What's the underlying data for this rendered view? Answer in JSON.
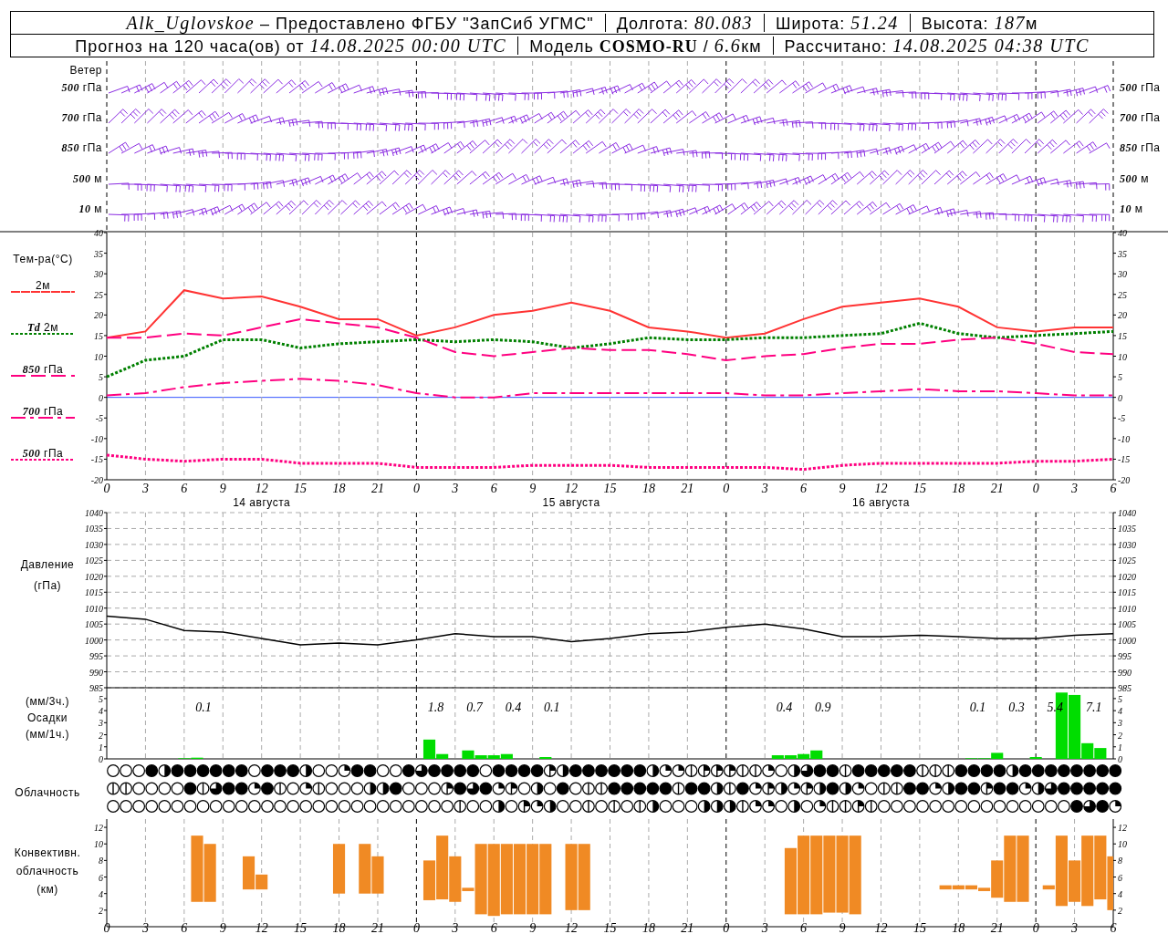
{
  "header": {
    "rows": [
      [
        {
          "parts": [
            {
              "kind": "italic",
              "text": "Alk_Uglovskoe"
            },
            {
              "kind": "plain",
              "text": " – Предоставлено ФГБУ \"ЗапСиб УГМС\""
            }
          ]
        },
        {
          "parts": [
            {
              "kind": "plain",
              "text": "Долгота: "
            },
            {
              "kind": "italic",
              "text": "80.083"
            }
          ]
        },
        {
          "parts": [
            {
              "kind": "plain",
              "text": "Широта: "
            },
            {
              "kind": "italic",
              "text": "51.24"
            }
          ]
        },
        {
          "parts": [
            {
              "kind": "plain",
              "text": "Высота: "
            },
            {
              "kind": "italic",
              "text": "187"
            },
            {
              "kind": "plain",
              "text": "м"
            }
          ]
        }
      ],
      [
        {
          "parts": [
            {
              "kind": "plain",
              "text": "Прогноз на 120 часа(ов) от "
            },
            {
              "kind": "italic",
              "text": "14.08.2025 00:00 UTC"
            }
          ]
        },
        {
          "parts": [
            {
              "kind": "plain",
              "text": "Модель "
            },
            {
              "kind": "bold",
              "text": "COSMO-RU"
            },
            {
              "kind": "plain",
              "text": " / "
            },
            {
              "kind": "italic",
              "text": "6.6"
            },
            {
              "kind": "plain",
              "text": "км"
            }
          ]
        },
        {
          "parts": [
            {
              "kind": "plain",
              "text": "Рассчитано: "
            },
            {
              "kind": "italic",
              "text": "14.08.2025 04:38 UTC"
            }
          ]
        }
      ]
    ]
  },
  "wind": {
    "title": "Ветер",
    "levels": [
      {
        "left": "500 гПа",
        "right": "500 гПа"
      },
      {
        "left": "700 гПа",
        "right": "700 гПа"
      },
      {
        "left": "850 гПа",
        "right": "850 гПа"
      },
      {
        "left": "500 м",
        "right": "500 м"
      },
      {
        "left": "10 м",
        "right": "10 м"
      }
    ]
  },
  "temperature": {
    "dates": [
      "14 августа",
      "15 августа",
      "16 августа"
    ],
    "right_axis_labels": [
      "40",
      "35",
      "30",
      "25",
      "20",
      "15",
      "10",
      "5",
      "0",
      "-5",
      "-10",
      "-15",
      "-20"
    ],
    "chart_data": {
      "type": "line",
      "ylabel": "Тем-ра(°C)",
      "grid": true,
      "legend": "left",
      "categories": [
        "0",
        "3",
        "6",
        "9",
        "12",
        "15",
        "18",
        "21",
        "0",
        "3",
        "6",
        "9",
        "12",
        "15",
        "18",
        "21",
        "0",
        "3",
        "6",
        "9",
        "12",
        "15",
        "18",
        "21",
        "0",
        "3",
        "6"
      ],
      "ylim": [
        -20,
        40
      ],
      "yticks": [
        -20,
        -15,
        -10,
        -5,
        0,
        5,
        10,
        15,
        20,
        25,
        30,
        35,
        40
      ],
      "series": [
        {
          "name": "2м",
          "color": "#ff3333",
          "line_style": "solid",
          "values": [
            14.5,
            16,
            26,
            24,
            24.5,
            22,
            19,
            19,
            15,
            17,
            20,
            21,
            23,
            21,
            17,
            16,
            14.5,
            15.5,
            19,
            22,
            23,
            24,
            22,
            17,
            16,
            17,
            17
          ]
        },
        {
          "name": "Td 2м",
          "color": "#008000",
          "line_style": "dotted",
          "values": [
            5,
            9,
            10,
            14,
            14,
            12,
            13,
            13.5,
            14,
            13.5,
            14,
            13.5,
            12,
            13,
            14.5,
            14,
            14,
            14.5,
            14.5,
            15,
            15.5,
            18,
            15.5,
            14.5,
            15,
            15.5,
            16
          ]
        },
        {
          "name": "850 гПа",
          "color": "#ff0080",
          "line_style": "dashed",
          "values": [
            14.5,
            14.5,
            15.5,
            15,
            17,
            19,
            18,
            17,
            14.5,
            11,
            10,
            11,
            12,
            11.5,
            11.5,
            10.5,
            9,
            10,
            10.5,
            12,
            13,
            13,
            14,
            14.5,
            13,
            11,
            10.5
          ]
        },
        {
          "name": "700 гПа",
          "color": "#ff0080",
          "line_style": "dashdot",
          "values": [
            0.5,
            1,
            2.5,
            3.5,
            4,
            4.5,
            4,
            3,
            1,
            0,
            0,
            1,
            1,
            1,
            1,
            1,
            1,
            0.5,
            0.5,
            1,
            1.5,
            2,
            1.5,
            1.5,
            1,
            0.5,
            0.5
          ]
        },
        {
          "name": "500 гПа",
          "color": "#ff0080",
          "line_style": "dotted",
          "values": [
            -14,
            -15,
            -15.5,
            -15,
            -15,
            -16,
            -16,
            -16,
            -17,
            -17,
            -17,
            -16.5,
            -16.5,
            -16.5,
            -17,
            -17,
            -17,
            -17,
            -17.5,
            -16.5,
            -16,
            -16,
            -16,
            -16,
            -15.5,
            -15.5,
            -15
          ]
        }
      ]
    }
  },
  "pressure": {
    "unit": "(гПа)",
    "right_axis_labels": [
      "1040",
      "1035",
      "1030",
      "1025",
      "1020",
      "1015",
      "1010",
      "1005",
      "1000",
      "995",
      "990",
      "985"
    ],
    "chart_data": {
      "type": "line",
      "ylabel": "Давление",
      "grid": true,
      "color": "#000000",
      "categories": [
        null,
        null,
        null,
        null,
        null,
        null,
        null,
        null,
        null,
        null,
        null,
        null,
        null,
        null,
        null,
        null,
        null,
        null,
        null,
        null,
        null,
        null,
        null,
        null,
        null,
        null,
        null
      ],
      "ylim": [
        985,
        1040
      ],
      "yticks": [
        985,
        990,
        995,
        1000,
        1005,
        1010,
        1015,
        1020,
        1025,
        1030,
        1035,
        1040
      ],
      "values": [
        1007.5,
        1006.5,
        1003,
        1002.5,
        1000.5,
        998.5,
        999,
        998.5,
        1000,
        1002,
        1001,
        1001,
        999.5,
        1000.5,
        1002,
        1002.5,
        1004,
        1005,
        1003.5,
        1001,
        1001,
        1001.5,
        1001,
        1000.5,
        1000.5,
        1001.5,
        1002
      ]
    }
  },
  "precipitation": {
    "labels": [
      "(мм/3ч.)",
      "Осадки",
      "(мм/1ч.)"
    ],
    "right_axis_labels": [
      "5",
      "4",
      "3",
      "2",
      "1",
      "0"
    ],
    "chart_data": {
      "type": "bar",
      "grid": true,
      "color": "#00dd00",
      "categories": [
        null,
        null,
        null,
        null,
        null,
        null,
        null,
        null,
        null,
        null,
        null,
        null,
        null,
        null,
        null,
        null,
        null,
        null,
        null,
        null,
        null,
        null,
        null,
        null,
        null,
        null,
        null,
        null,
        null,
        null,
        null,
        null,
        null,
        null,
        null,
        null,
        null,
        null,
        null,
        null,
        null,
        null,
        null,
        null,
        null,
        null,
        null,
        null,
        null,
        null,
        null,
        null,
        null,
        null,
        null,
        null,
        null,
        null,
        null,
        null,
        null,
        null,
        null,
        null,
        null,
        null,
        null,
        null,
        null,
        null,
        null,
        null,
        null,
        null,
        null,
        null,
        null,
        null,
        null
      ],
      "values": [
        0,
        0,
        0,
        0,
        0,
        0,
        0.05,
        0.1,
        0,
        0,
        0,
        0,
        0,
        0,
        0,
        0,
        0,
        0,
        0,
        0,
        0,
        0,
        0,
        0,
        0,
        1.6,
        0.4,
        0,
        0.7,
        0.3,
        0.3,
        0.4,
        0,
        0,
        0.15,
        0,
        0,
        0,
        0,
        0,
        0,
        0,
        0,
        0,
        0,
        0,
        0,
        0,
        0,
        0,
        0,
        0,
        0.3,
        0.3,
        0.4,
        0.7,
        0,
        0,
        0,
        0,
        0,
        0,
        0,
        0,
        0,
        0,
        0,
        0.05,
        0.05,
        0.5,
        0,
        0,
        0.15,
        0,
        5.5,
        5.3,
        1.3,
        0.9,
        0
      ],
      "ylim": [
        0,
        5.9
      ],
      "yticks": [
        0,
        1,
        2,
        3,
        4,
        5
      ],
      "annotations": [
        "0.1",
        "1.8",
        "0.7",
        "0.4",
        "0.1",
        "0.4",
        "0.9",
        "0.1",
        "0.3",
        "5.4",
        "7.1"
      ]
    }
  },
  "cloudiness": {
    "label": "Облачность",
    "rows": [
      {
        "cells": [
          {
            "kind": "clear"
          },
          {
            "kind": "clear"
          },
          {
            "kind": "clear"
          },
          {
            "kind": "overcast"
          },
          {
            "kind": "half"
          },
          {
            "kind": "overcast"
          },
          {
            "kind": "overcast"
          },
          {
            "kind": "overcast"
          },
          {
            "kind": "overcast"
          },
          {
            "kind": "overcast"
          },
          {
            "kind": "overcast"
          },
          {
            "kind": "clear"
          },
          {
            "kind": "overcast"
          },
          {
            "kind": "overcast"
          },
          {
            "kind": "overcast"
          },
          {
            "kind": "half"
          },
          {
            "kind": "clear"
          },
          {
            "kind": "clear"
          },
          {
            "kind": "quarter"
          },
          {
            "kind": "overcast"
          },
          {
            "kind": "overcast"
          },
          {
            "kind": "clear"
          },
          {
            "kind": "clear"
          },
          {
            "kind": "overcast"
          },
          {
            "kind": "three_quarters"
          },
          {
            "kind": "overcast"
          },
          {
            "kind": "overcast"
          },
          {
            "kind": "overcast"
          },
          {
            "kind": "overcast"
          },
          {
            "kind": "clear"
          },
          {
            "kind": "overcast"
          },
          {
            "kind": "overcast"
          },
          {
            "kind": "overcast"
          },
          {
            "kind": "overcast"
          },
          {
            "kind": "trace_quarter"
          },
          {
            "kind": "half"
          },
          {
            "kind": "overcast"
          },
          {
            "kind": "overcast"
          },
          {
            "kind": "overcast"
          },
          {
            "kind": "overcast"
          },
          {
            "kind": "overcast"
          },
          {
            "kind": "overcast"
          },
          {
            "kind": "half"
          },
          {
            "kind": "quarter"
          },
          {
            "kind": "quarter"
          },
          {
            "kind": "trace"
          },
          {
            "kind": "trace_quarter"
          },
          {
            "kind": "trace_quarter"
          },
          {
            "kind": "trace_quarter"
          },
          {
            "kind": "trace"
          },
          {
            "kind": "trace"
          },
          {
            "kind": "quarter"
          },
          {
            "kind": "clear"
          },
          {
            "kind": "half"
          },
          {
            "kind": "three_quarters"
          },
          {
            "kind": "overcast"
          },
          {
            "kind": "overcast"
          },
          {
            "kind": "trace"
          },
          {
            "kind": "overcast"
          },
          {
            "kind": "overcast"
          },
          {
            "kind": "overcast"
          },
          {
            "kind": "overcast"
          },
          {
            "kind": "overcast"
          },
          {
            "kind": "trace"
          },
          {
            "kind": "trace"
          },
          {
            "kind": "trace"
          },
          {
            "kind": "overcast"
          },
          {
            "kind": "overcast"
          },
          {
            "kind": "overcast"
          },
          {
            "kind": "overcast"
          },
          {
            "kind": "half"
          },
          {
            "kind": "overcast"
          },
          {
            "kind": "overcast"
          },
          {
            "kind": "overcast"
          },
          {
            "kind": "overcast"
          },
          {
            "kind": "overcast"
          },
          {
            "kind": "overcast"
          },
          {
            "kind": "overcast"
          },
          {
            "kind": "overcast"
          }
        ]
      },
      {
        "cells": [
          {
            "kind": "trace"
          },
          {
            "kind": "trace"
          },
          {
            "kind": "clear"
          },
          {
            "kind": "clear"
          },
          {
            "kind": "clear"
          },
          {
            "kind": "clear"
          },
          {
            "kind": "overcast"
          },
          {
            "kind": "trace"
          },
          {
            "kind": "three_quarters"
          },
          {
            "kind": "overcast"
          },
          {
            "kind": "overcast"
          },
          {
            "kind": "quarter"
          },
          {
            "kind": "overcast"
          },
          {
            "kind": "trace"
          },
          {
            "kind": "clear"
          },
          {
            "kind": "quarter"
          },
          {
            "kind": "trace"
          },
          {
            "kind": "clear"
          },
          {
            "kind": "clear"
          },
          {
            "kind": "clear"
          },
          {
            "kind": "half"
          },
          {
            "kind": "half"
          },
          {
            "kind": "overcast"
          },
          {
            "kind": "clear"
          },
          {
            "kind": "clear"
          },
          {
            "kind": "clear"
          },
          {
            "kind": "trace_quarter"
          },
          {
            "kind": "overcast"
          },
          {
            "kind": "three_quarters"
          },
          {
            "kind": "overcast"
          },
          {
            "kind": "quarter"
          },
          {
            "kind": "trace_quarter"
          },
          {
            "kind": "clear"
          },
          {
            "kind": "half"
          },
          {
            "kind": "clear"
          },
          {
            "kind": "overcast"
          },
          {
            "kind": "clear"
          },
          {
            "kind": "trace"
          },
          {
            "kind": "trace"
          },
          {
            "kind": "overcast"
          },
          {
            "kind": "overcast"
          },
          {
            "kind": "overcast"
          },
          {
            "kind": "overcast"
          },
          {
            "kind": "overcast"
          },
          {
            "kind": "trace"
          },
          {
            "kind": "overcast"
          },
          {
            "kind": "overcast"
          },
          {
            "kind": "half"
          },
          {
            "kind": "trace"
          },
          {
            "kind": "overcast"
          },
          {
            "kind": "quarter"
          },
          {
            "kind": "trace_quarter"
          },
          {
            "kind": "half"
          },
          {
            "kind": "quarter"
          },
          {
            "kind": "trace_quarter"
          },
          {
            "kind": "half"
          },
          {
            "kind": "overcast"
          },
          {
            "kind": "half"
          },
          {
            "kind": "quarter"
          },
          {
            "kind": "clear"
          },
          {
            "kind": "trace"
          },
          {
            "kind": "trace"
          },
          {
            "kind": "overcast"
          },
          {
            "kind": "overcast"
          },
          {
            "kind": "quarter"
          },
          {
            "kind": "half"
          },
          {
            "kind": "overcast"
          },
          {
            "kind": "overcast"
          },
          {
            "kind": "trace_quarter"
          },
          {
            "kind": "overcast"
          },
          {
            "kind": "overcast"
          },
          {
            "kind": "quarter"
          },
          {
            "kind": "half"
          },
          {
            "kind": "three_quarters"
          },
          {
            "kind": "overcast"
          },
          {
            "kind": "overcast"
          },
          {
            "kind": "overcast"
          },
          {
            "kind": "overcast"
          },
          {
            "kind": "overcast"
          }
        ]
      },
      {
        "cells": [
          {
            "kind": "clear"
          },
          {
            "kind": "clear"
          },
          {
            "kind": "clear"
          },
          {
            "kind": "clear"
          },
          {
            "kind": "clear"
          },
          {
            "kind": "clear"
          },
          {
            "kind": "clear"
          },
          {
            "kind": "clear"
          },
          {
            "kind": "clear"
          },
          {
            "kind": "clear"
          },
          {
            "kind": "clear"
          },
          {
            "kind": "clear"
          },
          {
            "kind": "clear"
          },
          {
            "kind": "clear"
          },
          {
            "kind": "clear"
          },
          {
            "kind": "clear"
          },
          {
            "kind": "clear"
          },
          {
            "kind": "clear"
          },
          {
            "kind": "clear"
          },
          {
            "kind": "clear"
          },
          {
            "kind": "clear"
          },
          {
            "kind": "clear"
          },
          {
            "kind": "clear"
          },
          {
            "kind": "clear"
          },
          {
            "kind": "clear"
          },
          {
            "kind": "clear"
          },
          {
            "kind": "clear"
          },
          {
            "kind": "trace"
          },
          {
            "kind": "clear"
          },
          {
            "kind": "clear"
          },
          {
            "kind": "half"
          },
          {
            "kind": "clear"
          },
          {
            "kind": "trace_quarter"
          },
          {
            "kind": "quarter"
          },
          {
            "kind": "half"
          },
          {
            "kind": "clear"
          },
          {
            "kind": "clear"
          },
          {
            "kind": "trace"
          },
          {
            "kind": "clear"
          },
          {
            "kind": "trace"
          },
          {
            "kind": "clear"
          },
          {
            "kind": "trace"
          },
          {
            "kind": "half"
          },
          {
            "kind": "clear"
          },
          {
            "kind": "clear"
          },
          {
            "kind": "clear"
          },
          {
            "kind": "half"
          },
          {
            "kind": "half"
          },
          {
            "kind": "half"
          },
          {
            "kind": "trace"
          },
          {
            "kind": "quarter"
          },
          {
            "kind": "quarter"
          },
          {
            "kind": "clear"
          },
          {
            "kind": "half"
          },
          {
            "kind": "clear"
          },
          {
            "kind": "quarter"
          },
          {
            "kind": "trace"
          },
          {
            "kind": "trace"
          },
          {
            "kind": "trace_quarter"
          },
          {
            "kind": "trace"
          },
          {
            "kind": "clear"
          },
          {
            "kind": "clear"
          },
          {
            "kind": "clear"
          },
          {
            "kind": "clear"
          },
          {
            "kind": "clear"
          },
          {
            "kind": "clear"
          },
          {
            "kind": "clear"
          },
          {
            "kind": "clear"
          },
          {
            "kind": "clear"
          },
          {
            "kind": "clear"
          },
          {
            "kind": "clear"
          },
          {
            "kind": "clear"
          },
          {
            "kind": "clear"
          },
          {
            "kind": "clear"
          },
          {
            "kind": "clear"
          },
          {
            "kind": "overcast"
          },
          {
            "kind": "three_quarters"
          },
          {
            "kind": "overcast"
          },
          {
            "kind": "quarter"
          }
        ]
      }
    ]
  },
  "convective": {
    "labels": [
      "Конвективн.",
      "облачность",
      "(км)"
    ],
    "right_axis_labels": [
      "12",
      "10",
      "8",
      "6",
      "4",
      "2"
    ],
    "chart_data": {
      "type": "candlestick",
      "grid": true,
      "color": "#f08a24",
      "categories": [
        "0",
        null,
        null,
        "3",
        null,
        null,
        "6",
        null,
        null,
        "9",
        null,
        null,
        "12",
        null,
        null,
        "15",
        null,
        null,
        "18",
        null,
        null,
        "21",
        null,
        null,
        "0",
        null,
        null,
        "3",
        null,
        null,
        "6",
        null,
        null,
        "9",
        null,
        null,
        "12",
        null,
        null,
        "15",
        null,
        null,
        "18",
        null,
        null,
        "21",
        null,
        null,
        "0",
        null,
        null,
        "3",
        null,
        null,
        "6",
        null,
        null,
        "9",
        null,
        null,
        "12",
        null,
        null,
        "15",
        null,
        null,
        "18",
        null,
        null,
        "21",
        null,
        null,
        "0",
        null,
        null,
        "3",
        null,
        null,
        "6"
      ],
      "ohlc": [
        null,
        null,
        null,
        null,
        null,
        null,
        null,
        [
          3,
          11,
          3,
          11
        ],
        [
          3,
          10,
          3,
          10
        ],
        null,
        null,
        [
          4.5,
          8.5,
          4.5,
          8.5
        ],
        [
          4.5,
          6.3,
          4.5,
          6.3
        ],
        null,
        null,
        null,
        null,
        null,
        [
          4,
          10,
          4,
          10
        ],
        null,
        [
          4,
          10,
          4,
          10
        ],
        [
          4,
          8.5,
          4,
          8.5
        ],
        null,
        null,
        null,
        [
          3.2,
          8,
          3.2,
          8
        ],
        [
          3.3,
          11,
          3.3,
          11
        ],
        [
          3,
          8.5,
          3,
          8.5
        ],
        [
          4.3,
          4.7,
          4.3,
          4.7
        ],
        [
          1.5,
          10,
          1.5,
          10
        ],
        [
          1.3,
          10,
          1.3,
          10
        ],
        [
          1.5,
          10,
          1.5,
          10
        ],
        [
          1.5,
          10,
          1.5,
          10
        ],
        [
          1.5,
          10,
          1.5,
          10
        ],
        [
          1.5,
          10,
          1.5,
          10
        ],
        null,
        [
          2,
          10,
          2,
          10
        ],
        [
          2,
          10,
          2,
          10
        ],
        null,
        null,
        null,
        null,
        null,
        null,
        null,
        null,
        null,
        null,
        null,
        null,
        null,
        null,
        null,
        [
          1.5,
          9.5,
          1.5,
          9.5
        ],
        [
          1.5,
          11,
          1.5,
          11
        ],
        [
          1.5,
          11,
          1.5,
          11
        ],
        [
          1.7,
          11,
          1.7,
          11
        ],
        [
          1.7,
          11,
          1.7,
          11
        ],
        [
          1.5,
          11,
          1.5,
          11
        ],
        null,
        null,
        null,
        null,
        null,
        null,
        [
          4.5,
          5,
          4.5,
          5
        ],
        [
          4.5,
          5,
          4.5,
          5
        ],
        [
          4.5,
          5,
          4.5,
          5
        ],
        [
          4.3,
          4.7,
          4.3,
          4.7
        ],
        [
          3.5,
          8,
          3.5,
          8
        ],
        [
          3,
          11,
          3,
          11
        ],
        [
          3,
          11,
          3,
          11
        ],
        null,
        [
          4.5,
          5,
          4.5,
          5
        ],
        [
          2.5,
          11,
          2.5,
          11
        ],
        [
          3,
          8,
          3,
          8
        ],
        [
          2.5,
          11,
          2.5,
          11
        ],
        [
          3.3,
          11,
          3.3,
          11
        ],
        [
          2,
          8.5,
          2,
          8.5
        ]
      ],
      "ylim": [
        0,
        13
      ],
      "yticks": [
        2,
        4,
        6,
        8,
        10,
        12
      ]
    }
  }
}
